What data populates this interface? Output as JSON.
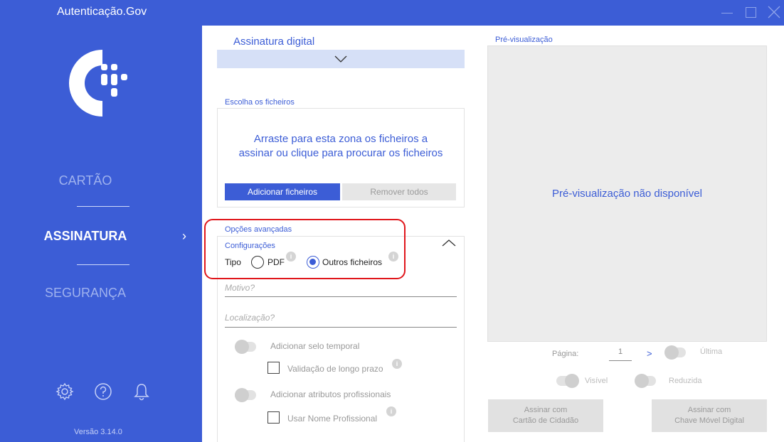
{
  "app": {
    "title": "Autenticação.Gov",
    "version": "Versão 3.14.0"
  },
  "window_controls": [
    "minimize-icon",
    "maximize-icon",
    "close-icon"
  ],
  "colors": {
    "accent": "#3c5dd6",
    "highlight": "#e0161b"
  },
  "sidebar": {
    "nav": [
      {
        "label": "CARTÃO",
        "active": false
      },
      {
        "label": "ASSINATURA",
        "active": true
      },
      {
        "label": "SEGURANÇA",
        "active": false
      }
    ],
    "bottom_icons": [
      "gear-icon",
      "help-icon",
      "bell-icon"
    ]
  },
  "main": {
    "section_title": "Assinatura digital",
    "files": {
      "label": "Escolha os ficheiros",
      "drop_text_line1": "Arraste para esta zona os ficheiros a",
      "drop_text_line2": "assinar ou clique para procurar os ficheiros",
      "add_button": "Adicionar ficheiros",
      "remove_button": "Remover todos"
    },
    "advanced": {
      "label": "Opções avançadas",
      "config_label": "Configurações",
      "type_label": "Tipo",
      "type_options": [
        {
          "label": "PDF",
          "selected": false
        },
        {
          "label": "Outros ficheiros",
          "selected": true
        }
      ],
      "reason_placeholder": "Motivo?",
      "location_placeholder": "Localização?",
      "timestamp_toggle": "Adicionar selo temporal",
      "long_term_validation": "Validação de longo prazo",
      "professional_attrs_toggle": "Adicionar atributos profissionais",
      "use_professional_name": "Usar Nome Profissional"
    }
  },
  "preview": {
    "title": "Pré-visualização",
    "unavailable_text": "Pré-visualização não disponível",
    "page_label": "Página:",
    "page_value": "1",
    "next_symbol": ">",
    "last_label": "Última",
    "visible_label": "Visível",
    "reduced_label": "Reduzida",
    "sign_cc_line1": "Assinar com",
    "sign_cc_line2": "Cartão de Cidadão",
    "sign_cmd_line1": "Assinar com",
    "sign_cmd_line2": "Chave Móvel Digital"
  }
}
